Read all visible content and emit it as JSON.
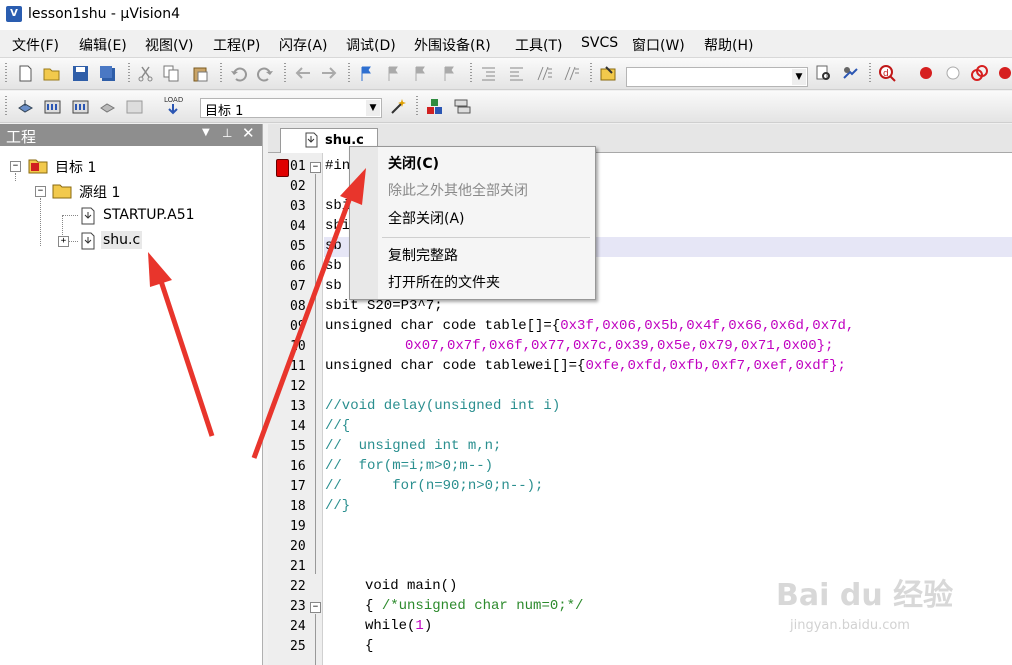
{
  "window": {
    "title": "lesson1shu  - µVision4",
    "app_icon_letter": "V"
  },
  "menu": [
    "文件(F)",
    "编辑(E)",
    "视图(V)",
    "工程(P)",
    "闪存(A)",
    "调试(D)",
    "外围设备(R)",
    "工具(T)",
    "SVCS",
    "窗口(W)",
    "帮助(H)"
  ],
  "toolbar2": {
    "target_select": "目标 1",
    "load_label": "LOAD"
  },
  "project": {
    "title": "工程",
    "tree": {
      "target": "目标 1",
      "group": "源组 1",
      "file1": "STARTUP.A51",
      "file2": "shu.c"
    }
  },
  "editor": {
    "tab": "shu.c",
    "line_numbers": [
      "01",
      "02",
      "03",
      "04",
      "05",
      "06",
      "07",
      "08",
      "09",
      "10",
      "11",
      "12",
      "13",
      "14",
      "15",
      "16",
      "17",
      "18",
      "19",
      "20",
      "21",
      "22",
      "23",
      "24",
      "25"
    ],
    "code": {
      "l01": "#in",
      "l03": "sbi",
      "l04": "sbi",
      "l05": "sb",
      "l06": "sb",
      "l07": "sb",
      "l08": "sbit S20=P3^7;",
      "l09a": "unsigned char code table[]={",
      "l09b": "0x3f,0x06,0x5b,0x4f,0x66,0x6d,0x7d,",
      "l10": "0x07,0x7f,0x6f,0x77,0x7c,0x39,0x5e,0x79,0x71,0x00};",
      "l11a": "unsigned char code tablewei[]={",
      "l11b": "0xfe,0xfd,0xfb,0xf7,0xef,0xdf};",
      "l13": "//void delay(unsigned int i)",
      "l14": "//{",
      "l15": "//  unsigned int m,n;",
      "l16": "//  for(m=i;m>0;m--)",
      "l17": "//      for(n=90;n>0;n--);",
      "l18": "//}",
      "l22": "void main()",
      "l23a": "{ ",
      "l23b": "/*unsigned char num=0;*/",
      "l24a": "while(",
      "l24b": "1",
      "l24c": ")",
      "l25": "{"
    }
  },
  "context_menu": {
    "close": "关闭(C)",
    "close_others": "除此之外其他全部关闭",
    "close_all": "全部关闭(A)",
    "copy_path": "复制完整路",
    "open_folder": "打开所在的文件夹"
  },
  "watermark": {
    "main": "Bai du 经验",
    "sub": "jingyan.baidu.com"
  },
  "colors": {
    "arrow": "#e8352c",
    "highlight_line": "#e6e6f6",
    "number": "#c000c0",
    "comment": "#2a8f8f"
  }
}
